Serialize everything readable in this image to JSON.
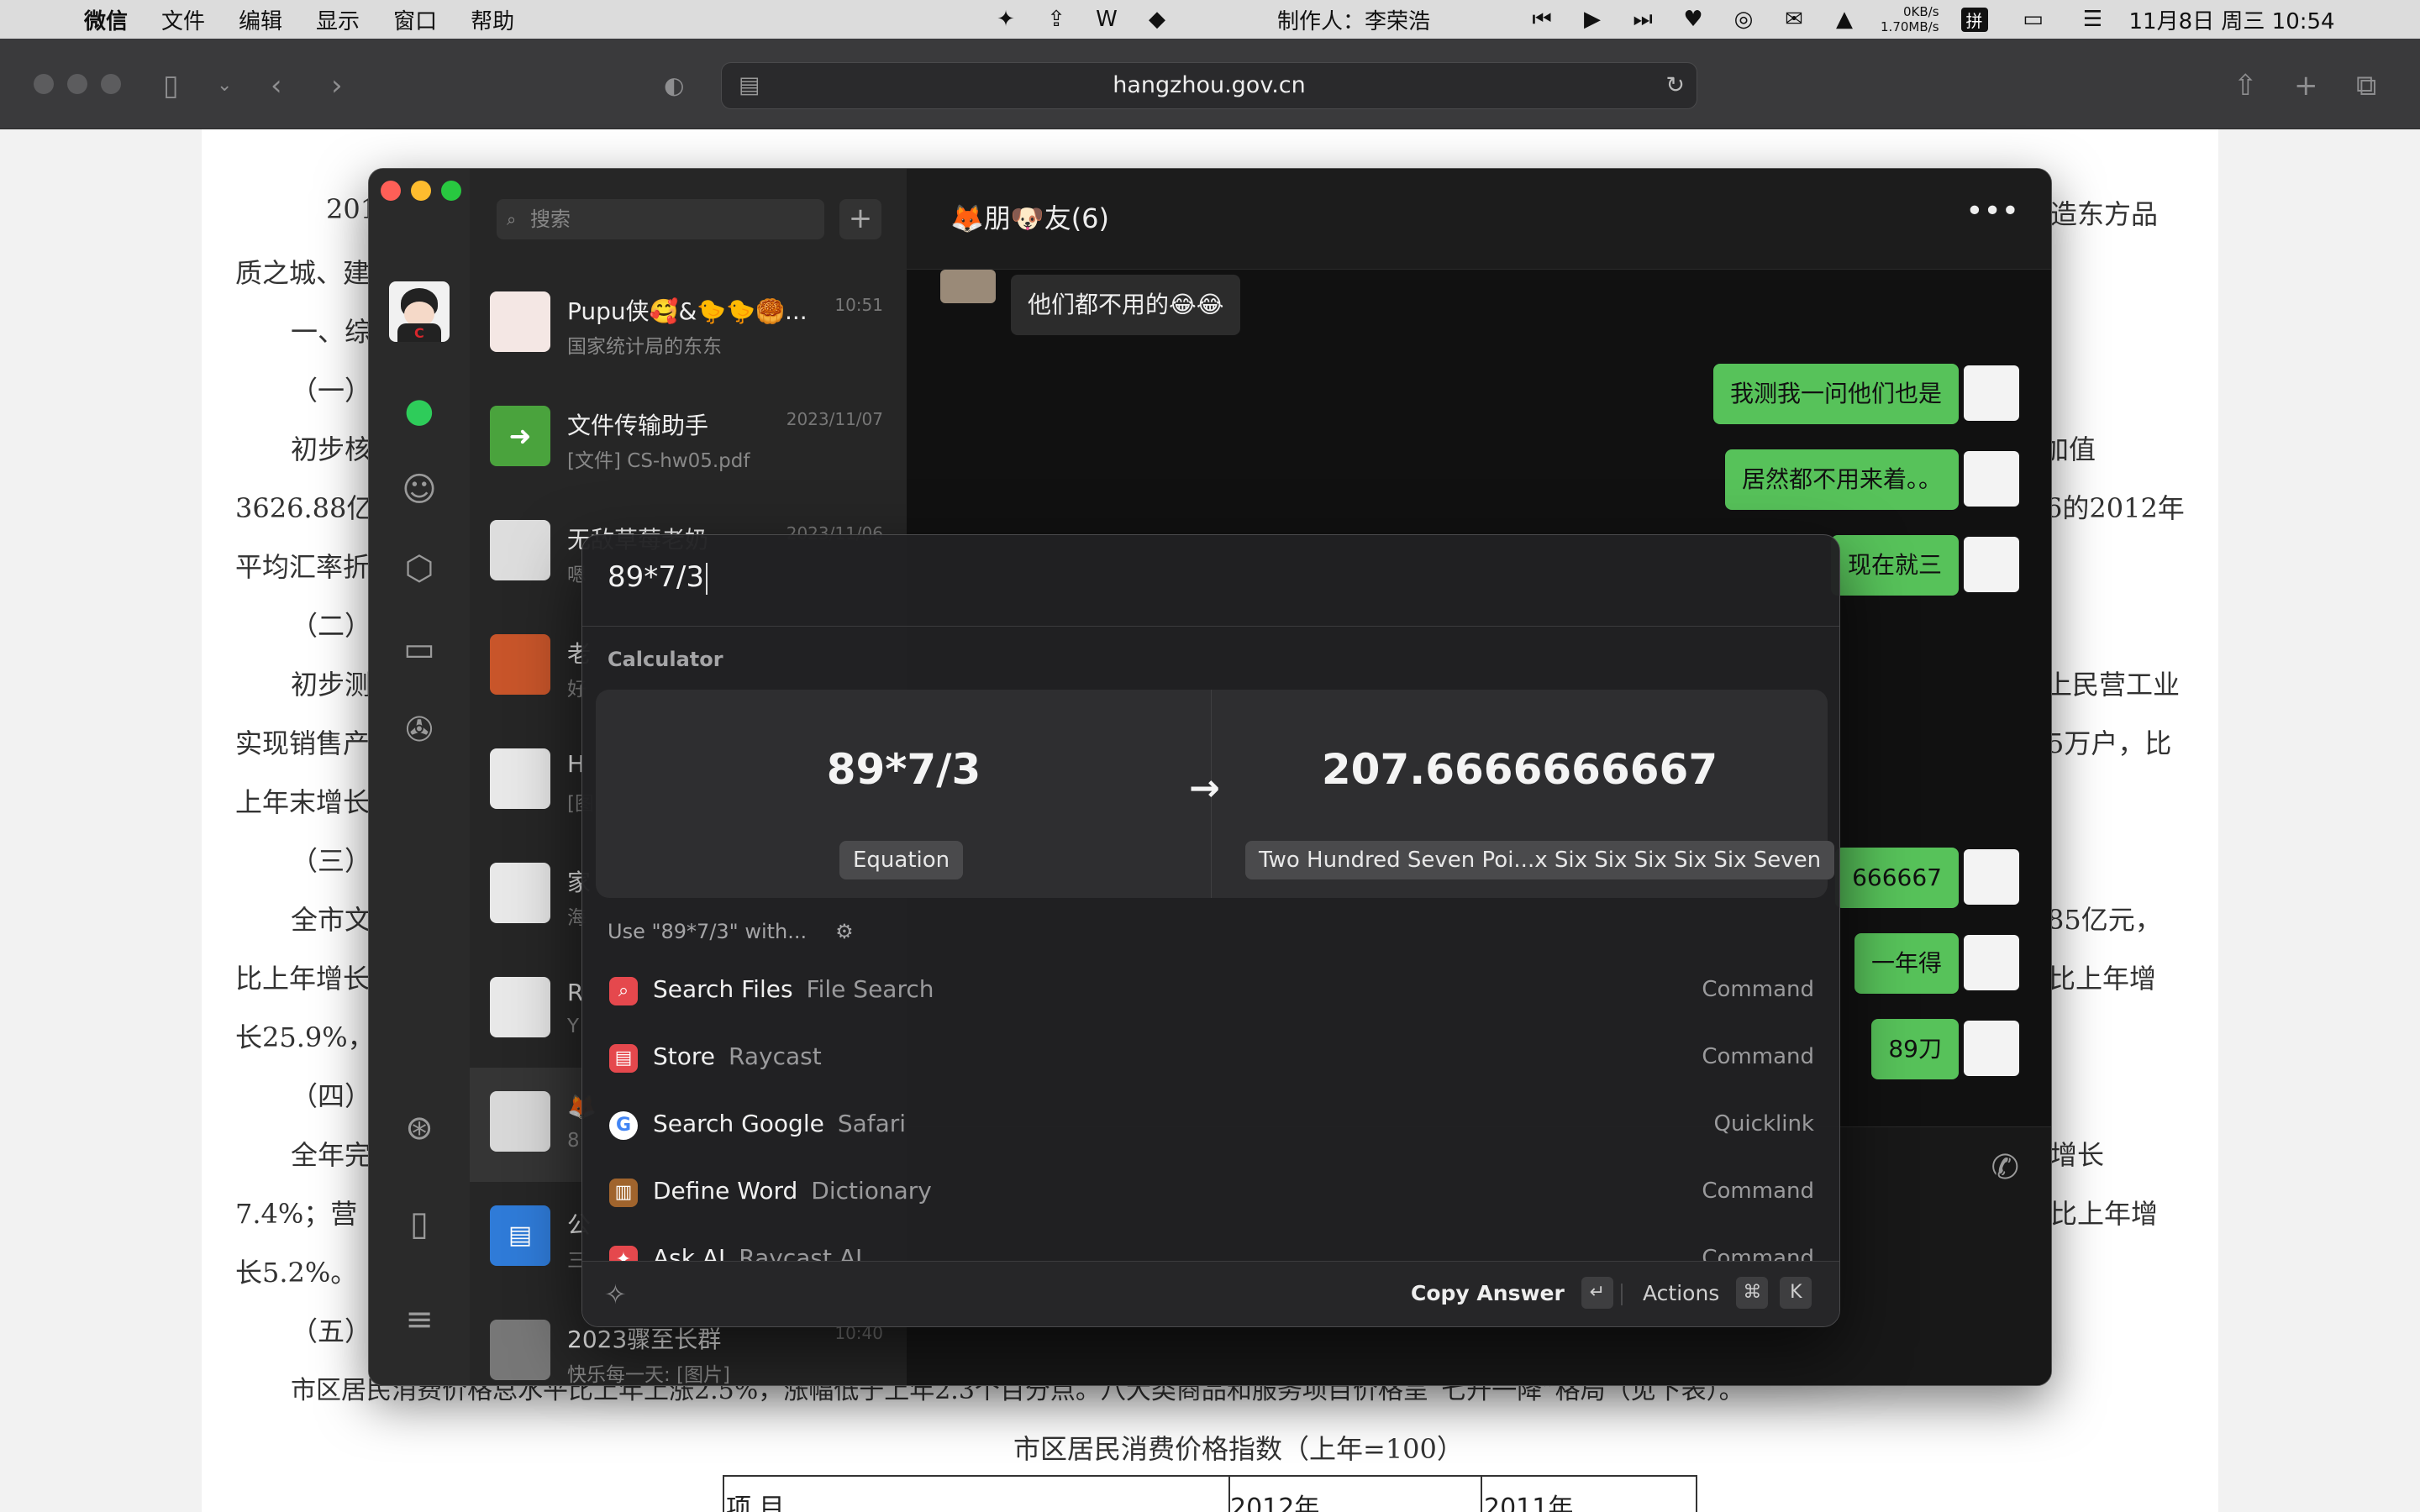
{
  "menubar": {
    "apple": "",
    "app_name": "微信",
    "menus": [
      "文件",
      "编辑",
      "显示",
      "窗口",
      "帮助"
    ],
    "author": "制作人：李荣浩",
    "net_up": "0KB/s",
    "net_down": "1.70MB/s",
    "input_method": "拼",
    "datetime": "11月8日 周三  10:54"
  },
  "browser": {
    "url": "hangzhou.gov.cn"
  },
  "document": {
    "lines": [
      "201",
      "造东方品",
      "质之城、建",
      "一、综",
      "（一）",
      "初步核",
      "加值",
      "3626.88亿",
      "6的2012年",
      "平均汇率折",
      "（二）",
      "初步测",
      "上民营工业",
      "实现销售产",
      "5万户，比",
      "上年末增长",
      "（三）",
      "全市文",
      "85亿元，",
      "比上年增长",
      "比上年增",
      "长25.9%，",
      "（四）",
      "全年完",
      "增长",
      "7.4%；营",
      "比上年增",
      "长5.2%。",
      "（五）",
      "市区居民消费价格总水平比上年上涨2.5%，涨幅低于上年2.3个百分点。八大类商品和服务项目价格呈“七升一降”格局（见下表）。",
      "市区居民消费价格指数（上年=100）"
    ],
    "table_headers": [
      "项  目",
      "2012年",
      "2011年"
    ]
  },
  "wechat": {
    "search_placeholder": "搜索",
    "plus": "+",
    "chat_title": "🦊朋🐶友(6)",
    "more": "•••",
    "conversations": [
      {
        "name": "Pupu侠🥰&🐤🐤🥮...",
        "sub": "国家统计局的东东",
        "time": "10:51"
      },
      {
        "name": "文件传输助手",
        "sub": "[文件] CS-hw05.pdf",
        "time": "2023/11/07"
      },
      {
        "name": "无敌草莓老奶",
        "sub": "嗯",
        "time": "2023/11/06"
      },
      {
        "name": "老",
        "sub": "好",
        "time": ""
      },
      {
        "name": "H",
        "sub": "[图",
        "time": ""
      },
      {
        "name": "家",
        "sub": "海",
        "time": ""
      },
      {
        "name": "R",
        "sub": "Y",
        "time": ""
      },
      {
        "name": "🦊",
        "sub": "8",
        "time": ""
      },
      {
        "name": "公",
        "sub": "三",
        "time": ""
      },
      {
        "name": "2023骤至长群",
        "sub": "快乐每一天: [图片]",
        "time": "10:40"
      }
    ],
    "messages": [
      {
        "text": "他们都不用的😂😂",
        "dir": "in"
      },
      {
        "text": "我测我一问他们也是",
        "dir": "out"
      },
      {
        "text": "居然都不用来着。。",
        "dir": "out"
      },
      {
        "text": "现在就三",
        "dir": "out"
      },
      {
        "text": "666667",
        "dir": "out"
      },
      {
        "text": "一年得",
        "dir": "out"
      },
      {
        "text": "89刀",
        "dir": "out"
      }
    ]
  },
  "raycast": {
    "query": "89*7/3",
    "section": "Calculator",
    "equation": "89*7/3",
    "equation_label": "Equation",
    "answer": "207.6666666667",
    "answer_words": "Two Hundred Seven Poi...x Six Six Six Six Six Seven",
    "use_with": "Use \"89*7/3\" with...",
    "items": [
      {
        "title": "Search Files",
        "subtitle": "File Search",
        "kind": "Command",
        "icon": "search-files-icon",
        "color": "#e5484d"
      },
      {
        "title": "Store",
        "subtitle": "Raycast",
        "kind": "Command",
        "icon": "store-icon",
        "color": "#e5484d"
      },
      {
        "title": "Search Google",
        "subtitle": "Safari",
        "kind": "Quicklink",
        "icon": "google-icon",
        "color": "#ffffff"
      },
      {
        "title": "Define Word",
        "subtitle": "Dictionary",
        "kind": "Command",
        "icon": "dictionary-icon",
        "color": "#a0642d"
      },
      {
        "title": "Ask AI",
        "subtitle": "Raycast AI",
        "kind": "Command",
        "icon": "ai-icon",
        "color": "#e5484d"
      }
    ],
    "footer": {
      "copy_answer": "Copy Answer",
      "enter_key": "↵",
      "actions": "Actions",
      "cmd_key": "⌘",
      "k_key": "K"
    }
  }
}
